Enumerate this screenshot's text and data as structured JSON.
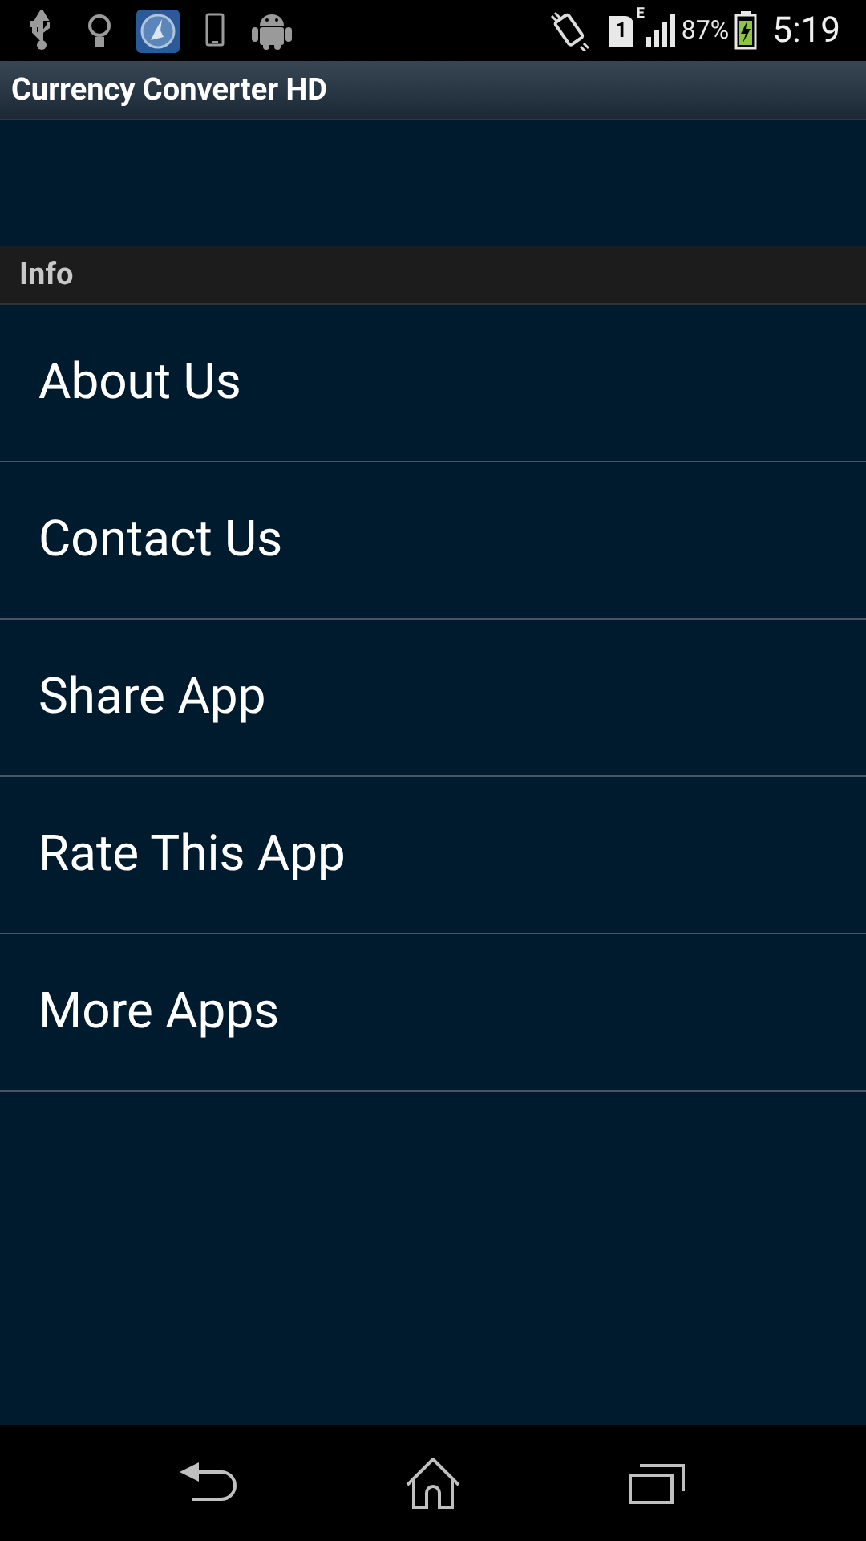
{
  "status_bar": {
    "sim_label": "1",
    "network_type": "E",
    "battery": "87%",
    "time": "5:19"
  },
  "app_bar": {
    "title": "Currency Converter HD"
  },
  "section": {
    "header": "Info",
    "items": [
      {
        "label": "About Us"
      },
      {
        "label": "Contact Us"
      },
      {
        "label": "Share App"
      },
      {
        "label": "Rate This App"
      },
      {
        "label": "More Apps"
      }
    ]
  }
}
